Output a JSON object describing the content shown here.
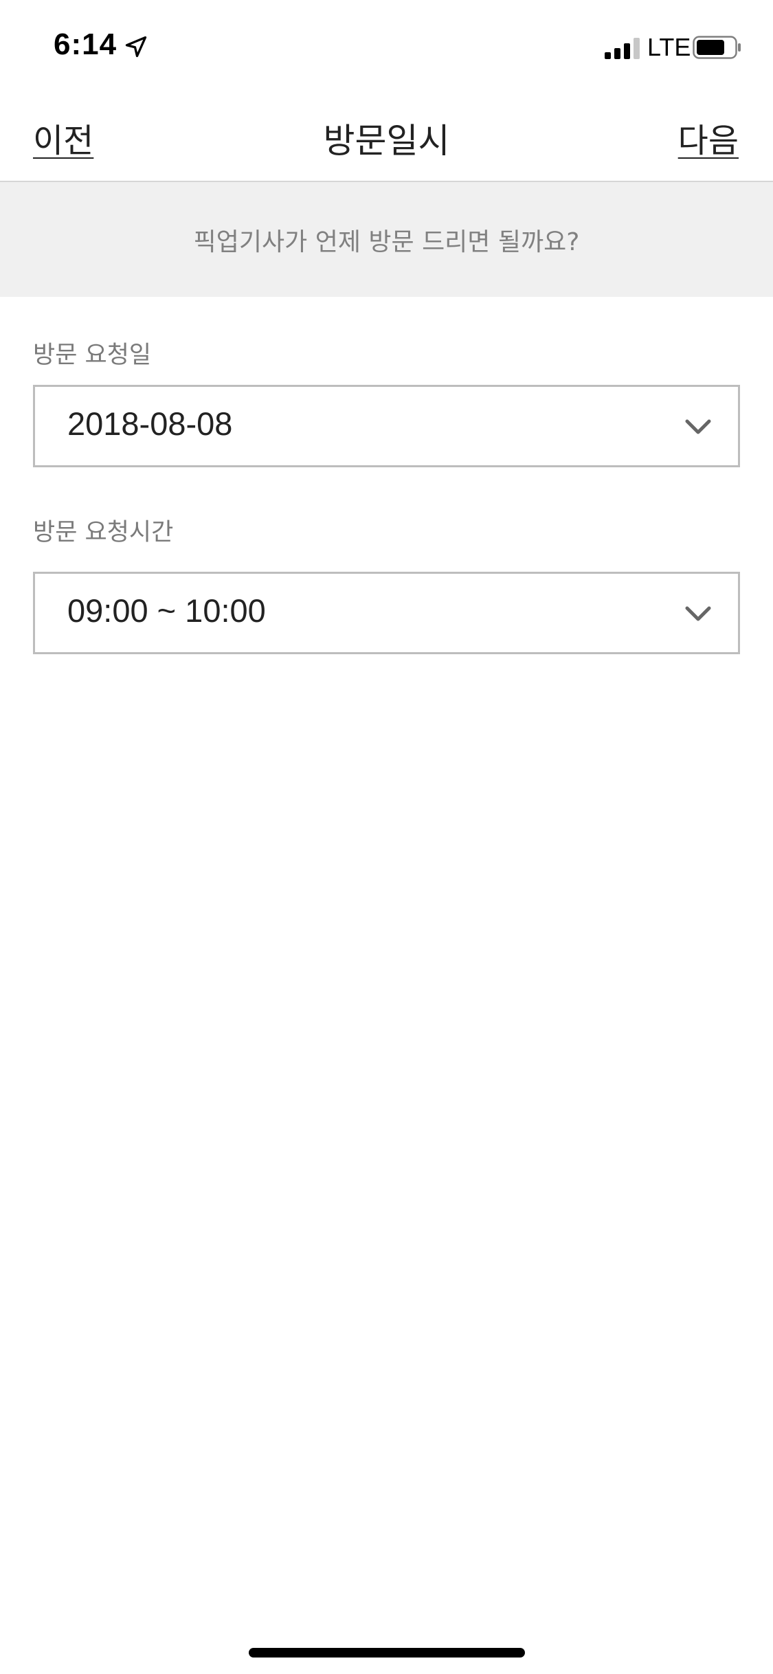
{
  "status_bar": {
    "time": "6:14",
    "network": "LTE",
    "icons": [
      "location-arrow-icon",
      "cellular-signal-icon",
      "battery-icon"
    ]
  },
  "header": {
    "prev_label": "이전",
    "title": "방문일시",
    "next_label": "다음"
  },
  "banner": {
    "text": "픽업기사가 언제 방문 드리면 될까요?"
  },
  "form": {
    "date": {
      "label": "방문 요청일",
      "value": "2018-08-08"
    },
    "time": {
      "label": "방문 요청시간",
      "value": "09:00 ~ 10:00"
    }
  },
  "colors": {
    "text": "#222222",
    "label": "#7a7a7a",
    "banner_bg": "#f0f0f0",
    "border": "#bdbdbd",
    "chevron": "#666666"
  }
}
